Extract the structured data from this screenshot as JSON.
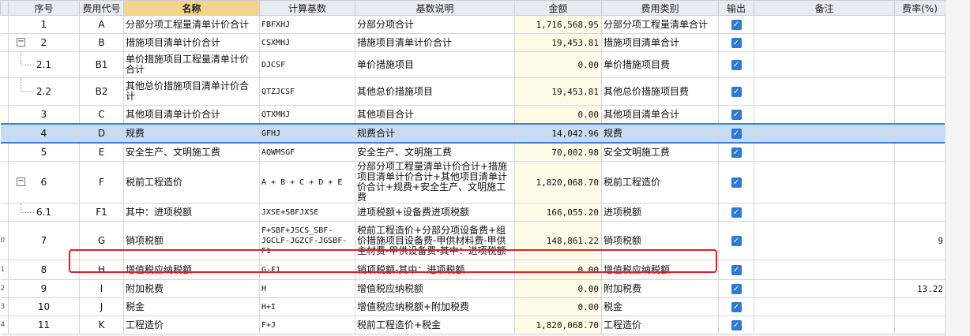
{
  "headers": {
    "seq": "序号",
    "code": "费用代号",
    "name": "名称",
    "base": "计算基数",
    "desc": "基数说明",
    "amount": "金额",
    "category": "费用类别",
    "output": "输出",
    "remark": "备注",
    "rate": "费率(%)"
  },
  "rows": [
    {
      "edge": "",
      "seq": "1",
      "code": "A",
      "name": "分部分项工程量清单计价合计",
      "base": "FBFXHJ",
      "desc": "分部分项合计",
      "amount": "1,716,568.95",
      "category": "分部分项工程量清单合计",
      "output": true,
      "rate": ""
    },
    {
      "edge": "",
      "seq": "2",
      "code": "B",
      "name": "措施项目清单计价合计",
      "base": "CSXMHJ",
      "desc": "措施项目清单计价合计",
      "amount": "19,453.81",
      "category": "措施项目清单合计",
      "output": true,
      "rate": "",
      "toggle": "−"
    },
    {
      "edge": "",
      "seq": "2.1",
      "code": "B1",
      "name": "单价措施项目工程量清单计价合计",
      "base": "DJCSF",
      "desc": "单价措施项目",
      "amount": "0.00",
      "category": "单价措施项目费",
      "output": true,
      "rate": ""
    },
    {
      "edge": "",
      "seq": "2.2",
      "code": "B2",
      "name": "其他总价措施项目清单计价合计",
      "base": "QTZJCSF",
      "desc": "其他总价措施项目",
      "amount": "19,453.81",
      "category": "其他总价措施项目费",
      "output": true,
      "rate": ""
    },
    {
      "edge": "",
      "seq": "3",
      "code": "C",
      "name": "其他项目清单计价合计",
      "base": "QTXMHJ",
      "desc": "其他项目合计",
      "amount": "0.00",
      "category": "其他项目清单合计",
      "output": true,
      "rate": ""
    },
    {
      "edge": "",
      "seq": "4",
      "code": "D",
      "name": "规费",
      "base": "GFHJ",
      "desc": "规费合计",
      "amount": "14,042.96",
      "category": "规费",
      "output": true,
      "rate": "",
      "selected": true
    },
    {
      "edge": "",
      "seq": "5",
      "code": "E",
      "name": "安全生产、文明施工费",
      "base": "AQWMSGF",
      "desc": "安全生产、文明施工费",
      "amount": "70,002.98",
      "category": "安全文明施工费",
      "output": true,
      "rate": ""
    },
    {
      "edge": "",
      "seq": "6",
      "code": "F",
      "name": "税前工程造价",
      "base": "A + B + C + D + E",
      "desc": "分部分项工程量清单计价合计+措施项目清单计价合计+其他项目清单计价合计+规费+安全生产、文明施工费",
      "amount": "1,820,068.70",
      "category": "税前工程造价",
      "output": true,
      "rate": "",
      "toggle": "−"
    },
    {
      "edge": "",
      "seq": "6.1",
      "code": "F1",
      "name": "其中：进项税额",
      "base": "JXSE+SBFJXSE",
      "desc": "进项税额+设备费进项税额",
      "amount": "166,055.20",
      "category": "进项税额",
      "output": true,
      "rate": ""
    },
    {
      "edge": "0",
      "seq": "7",
      "code": "G",
      "name": "销项税额",
      "base": "F+SBF+JSCS_SBF-JGCLF-JGZCF-JGSBF-F1",
      "desc": "税前工程造价+分部分项设备费+组价措施项目设备费-甲供材料费-甲供主材费-甲供设备费-其中：进项税额",
      "amount": "148,861.22",
      "category": "销项税额",
      "output": true,
      "rate": "9"
    },
    {
      "edge": "1",
      "seq": "8",
      "code": "H",
      "name": "增值税应纳税额",
      "base": "G-F1",
      "desc": "销项税额-其中：进项税额",
      "amount": "0.00",
      "category": "增值税应纳税额",
      "output": true,
      "rate": ""
    },
    {
      "edge": "2",
      "seq": "9",
      "code": "I",
      "name": "附加税费",
      "base": "H",
      "desc": "增值税应纳税额",
      "amount": "0.00",
      "category": "附加税费",
      "output": true,
      "rate": "13.22"
    },
    {
      "edge": "3",
      "seq": "10",
      "code": "J",
      "name": "税金",
      "base": "H+I",
      "desc": "增值税应纳税额+附加税费",
      "amount": "0.00",
      "category": "税金",
      "output": true,
      "rate": ""
    },
    {
      "edge": "4",
      "seq": "11",
      "code": "K",
      "name": "工程造价",
      "base": "F+J",
      "desc": "税前工程造价+税金",
      "amount": "1,820,068.70",
      "category": "工程造价",
      "output": true,
      "rate": ""
    }
  ],
  "icons": {
    "checkbox": "checkbox-checked-icon",
    "toggle": "collapse-icon"
  },
  "colors": {
    "highlight": "#e02020",
    "selection": "#3d7fd6",
    "header_name": "#f3d48a",
    "checkbox": "#2c79d6"
  }
}
